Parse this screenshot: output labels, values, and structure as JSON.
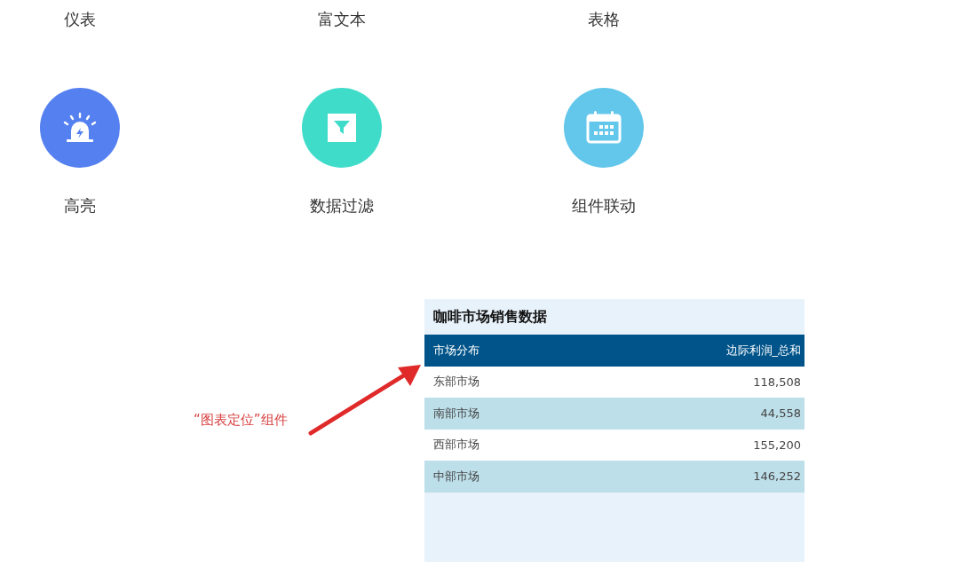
{
  "categories": [
    {
      "label": "仪表"
    },
    {
      "label": "富文本"
    },
    {
      "label": "表格"
    }
  ],
  "features": [
    {
      "kind": "alarm",
      "label": "高亮",
      "color": "#5580f0"
    },
    {
      "kind": "filter",
      "label": "数据过滤",
      "color": "#3fdcca"
    },
    {
      "kind": "calendar",
      "label": "组件联动",
      "color": "#62c7ea"
    }
  ],
  "annotation": {
    "text": "“图表定位”组件"
  },
  "table": {
    "title": "咖啡市场销售数据",
    "columns": [
      "市场分布",
      "边际利润_总和"
    ],
    "rows": [
      [
        "东部市场",
        "118,508"
      ],
      [
        "南部市场",
        "44,558"
      ],
      [
        "西部市场",
        "155,200"
      ],
      [
        "中部市场",
        "146,252"
      ]
    ]
  }
}
